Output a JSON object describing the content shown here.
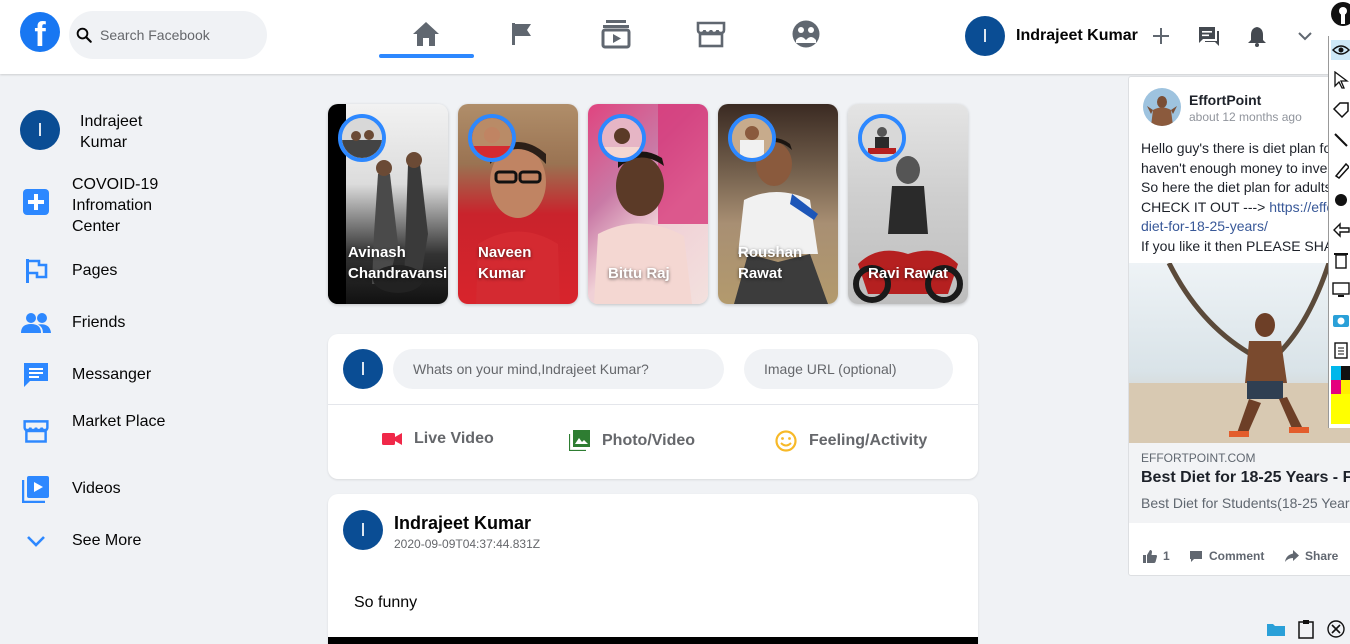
{
  "header": {
    "logo_letter": "f",
    "search_placeholder": "Search Facebook",
    "nav_icons": [
      "home-icon",
      "flag-icon",
      "watch-icon",
      "marketplace-icon",
      "groups-icon"
    ],
    "user_initial": "I",
    "user_name": "Indrajeet Kumar"
  },
  "sidebar": {
    "user_initial": "I",
    "user_name": "Indrajeet Kumar",
    "items": [
      {
        "label": "COVOID-19 Infromation Center",
        "icon": "covid-info-icon"
      },
      {
        "label": "Pages",
        "icon": "pages-flag-icon"
      },
      {
        "label": "Friends",
        "icon": "friends-icon"
      },
      {
        "label": "Messanger",
        "icon": "messenger-icon"
      },
      {
        "label": "Market Place",
        "icon": "marketplace-icon"
      },
      {
        "label": "Videos",
        "icon": "videos-icon"
      },
      {
        "label": "See More",
        "icon": "chevron-down-icon"
      }
    ]
  },
  "stories": [
    {
      "name": "Avinash Chandravansi"
    },
    {
      "name": "Naveen Kumar"
    },
    {
      "name": "Bittu Raj"
    },
    {
      "name": "Roushan Rawat"
    },
    {
      "name": "Ravi Rawat"
    }
  ],
  "composer": {
    "user_initial": "I",
    "text_placeholder": "Whats on your mind,Indrajeet Kumar?",
    "url_placeholder": "Image URL (optional)",
    "options": [
      {
        "label": "Live Video",
        "color": "#f02849"
      },
      {
        "label": "Photo/Video",
        "color": "#45bd62"
      },
      {
        "label": "Feeling/Activity",
        "color": "#f7b928"
      }
    ]
  },
  "post": {
    "user_initial": "I",
    "author": "Indrajeet Kumar",
    "timestamp": "2020-09-09T04:37:44.831Z",
    "text": "So funny"
  },
  "ad": {
    "page_name": "EffortPoint",
    "time": "about 12 months ago",
    "lines": [
      "Hello guy's there is diet plan fo",
      "haven't enough money to inve",
      "So here the diet plan for adults",
      "CHECK IT OUT ---> "
    ],
    "link_part1": "https://effo",
    "link_part2": "diet-for-18-25-years/",
    "last_line": "If you like it then PLEASE SHA",
    "domain": "EFFORTPOINT.COM",
    "title": "Best Diet for 18-25 Years - F",
    "description": "Best Diet for Students(18-25 Year",
    "like_count": "1",
    "comment_label": "Comment",
    "share_label": "Share"
  },
  "colors": {
    "brand": "#1877f2",
    "accent": "#2d88ff",
    "avatar": "#0a4d94"
  }
}
